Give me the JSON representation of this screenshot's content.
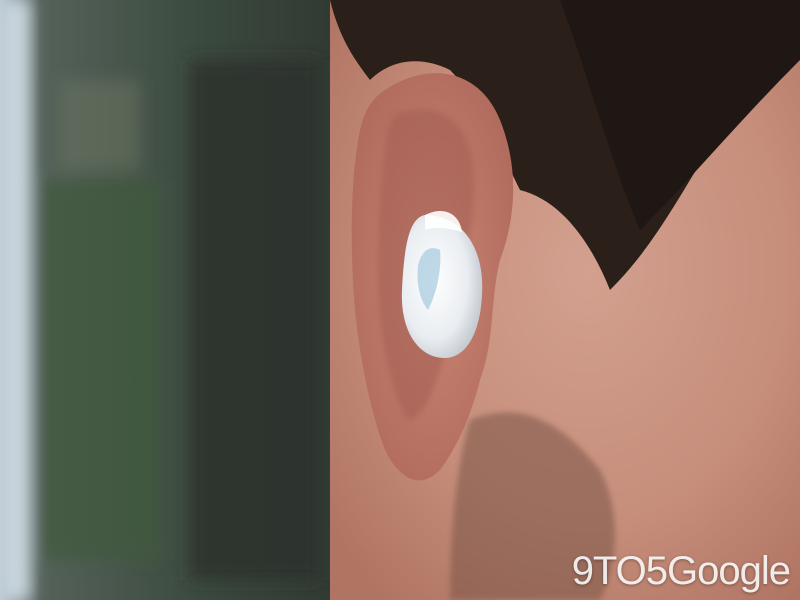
{
  "photo": {
    "subject": "earbud-in-ear",
    "watermark_text": "9TO5Google",
    "colors": {
      "background": "#3b4640",
      "hair": "#2a1f19",
      "skin": "#c99583",
      "earbud": "#eef1f4",
      "earbud_accent": "#a9cce0"
    }
  }
}
